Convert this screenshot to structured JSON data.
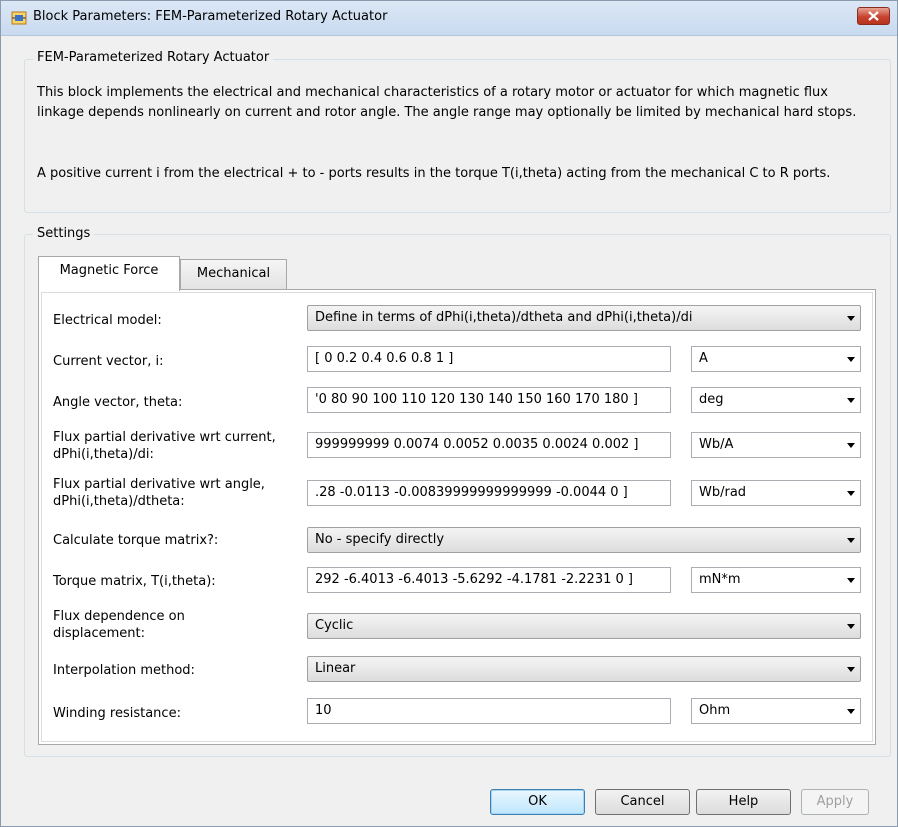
{
  "window": {
    "title": "Block Parameters: FEM-Parameterized Rotary Actuator"
  },
  "block": {
    "name": "FEM-Parameterized Rotary Actuator",
    "description_1": "This block implements the electrical and mechanical characteristics of a rotary motor or actuator for which magnetic flux linkage depends nonlinearly on current and rotor angle. The angle range may optionally be limited by mechanical hard stops.",
    "description_2": "A positive current i from the electrical + to - ports results in the torque T(i,theta) acting from the mechanical C to R ports."
  },
  "settings": {
    "legend": "Settings",
    "tabs": [
      {
        "label": "Magnetic Force",
        "active": true
      },
      {
        "label": "Mechanical",
        "active": false
      }
    ],
    "params": [
      {
        "label": "Electrical model:",
        "value": "Define in terms of dPhi(i,theta)/dtheta and dPhi(i,theta)/di"
      },
      {
        "label": "Current vector, i:",
        "value": "[ 0 0.2 0.4 0.6 0.8 1 ]",
        "unit": "A"
      },
      {
        "label": "Angle vector, theta:",
        "value": "'0 80 90 100 110 120 130 140 150 160 170 180 ]",
        "unit": "deg"
      },
      {
        "label": "Flux partial derivative wrt current, dPhi(i,theta)/di:",
        "value": "999999999 0.0074 0.0052 0.0035 0.0024 0.002 ]",
        "unit": "Wb/A"
      },
      {
        "label": "Flux partial derivative wrt angle, dPhi(i,theta)/dtheta:",
        "value": ".28 -0.0113 -0.00839999999999999 -0.0044 0 ]",
        "unit": "Wb/rad"
      },
      {
        "label": "Calculate torque matrix?:",
        "value": "No - specify directly"
      },
      {
        "label": "Torque matrix, T(i,theta):",
        "value": "292 -6.4013 -6.4013 -5.6292 -4.1781 -2.2231 0 ]",
        "unit": "mN*m"
      },
      {
        "label": "Flux dependence on displacement:",
        "value": "Cyclic"
      },
      {
        "label": "Interpolation method:",
        "value": "Linear"
      },
      {
        "label": "Winding resistance:",
        "value": "10",
        "unit": "Ohm"
      }
    ]
  },
  "buttons": {
    "ok": "OK",
    "cancel": "Cancel",
    "help": "Help",
    "apply": "Apply"
  },
  "colors": {
    "title_bar": "#c9daf0",
    "close_button": "#c7432f",
    "dialog_bg": "#f0f0f0",
    "default_button": "#bee6fd"
  }
}
